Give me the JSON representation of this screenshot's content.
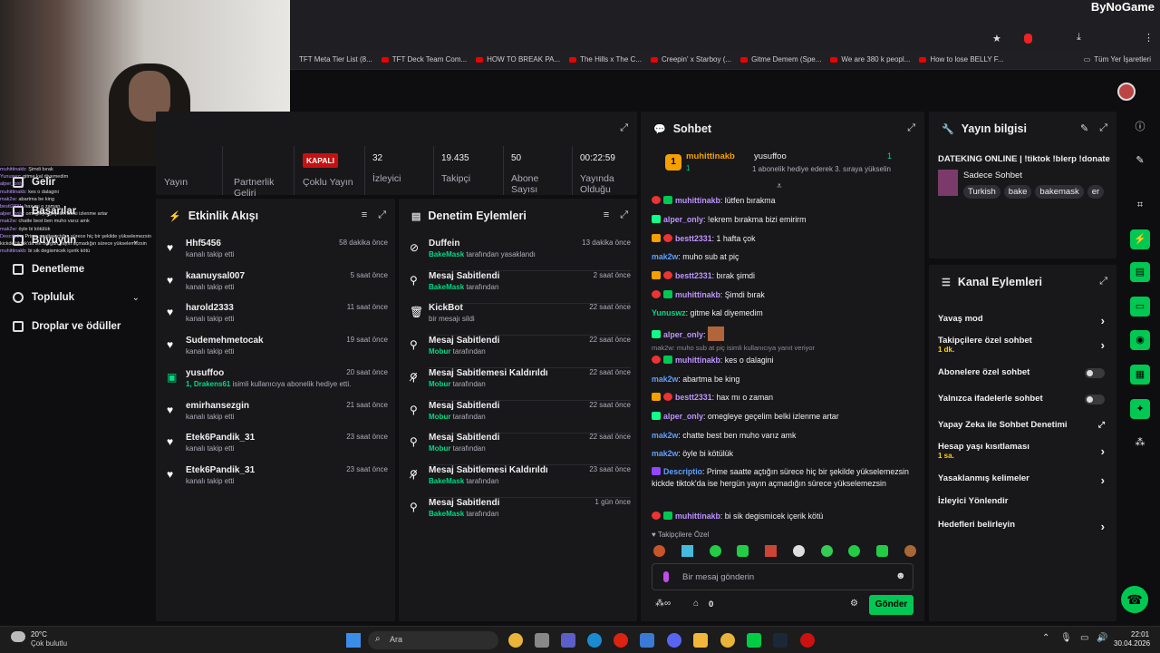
{
  "browser": {
    "brand": "ByNoGame",
    "bookmarks": [
      "TFT Meta Tier List (8...",
      "TFT Deck Team Com...",
      "HOW TO BREAK PA...",
      "The Hills x The C...",
      "Creepin' x Starboy (...",
      "Gitme Demem (Spe...",
      "We are 380 k peopl...",
      "How to lose BELLY F..."
    ],
    "all_bookmarks": "Tüm Yer İşaretleri"
  },
  "nav": {
    "items": [
      {
        "label": "Gelir"
      },
      {
        "label": "Başarılar"
      },
      {
        "label": "Büyüyün"
      },
      {
        "label": "Denetleme"
      },
      {
        "label": "Topluluk"
      },
      {
        "label": "Droplar ve ödüller"
      }
    ]
  },
  "minichat": [
    {
      "u": "muhittinakb",
      "t": "Şimdi bırak"
    },
    {
      "u": "Yunuswz",
      "t": "gitme kal diyemedim"
    },
    {
      "u": "alper_only",
      "t": ""
    },
    {
      "u": "muhittinakb",
      "t": "kes o dalagini"
    },
    {
      "u": "mak2w",
      "t": "abartma be king"
    },
    {
      "u": "bestt2331",
      "t": "hax mı o zaman"
    },
    {
      "u": "alper_only",
      "t": "omegleye geçelim belki izlenme artar"
    },
    {
      "u": "mak2w",
      "t": "chatte best ben muho varız amk"
    },
    {
      "u": "mak2w",
      "t": "öyle bi kötülük"
    },
    {
      "u": "Descriptio",
      "t": "Prime saatte açtığın sürece hiç bir şekilde yükselemezsin kickde tiktok'da ise hergün yayın açmadığın sürece yükselemezsin"
    },
    {
      "u": "muhittinakb",
      "t": "bi sik degismicek içerik kötü"
    }
  ],
  "stats": {
    "labels": [
      "Yayın",
      "Partnerlik Geliri",
      "Çoklu Yayın",
      "İzleyici",
      "Takipçi",
      "Abone Sayısı",
      "Yayında Olduğu"
    ],
    "multistream_status": "KAPALI",
    "viewers": "32",
    "followers": "19.435",
    "subs": "50",
    "uptime": "00:22:59"
  },
  "activity": {
    "title": "Etkinlik Akışı",
    "rows": [
      {
        "name": "Hhf5456",
        "sub": "kanalı takip etti",
        "time": "58 dakika önce",
        "icon": "heart"
      },
      {
        "name": "kaanuysal007",
        "sub": "kanalı takip etti",
        "time": "5 saat önce",
        "icon": "heart"
      },
      {
        "name": "harold2333",
        "sub": "kanalı takip etti",
        "time": "11 saat önce",
        "icon": "heart"
      },
      {
        "name": "Sudemehmetocak",
        "sub": "kanalı takip etti",
        "time": "19 saat önce",
        "icon": "heart"
      },
      {
        "name": "yusuffoo",
        "sub": "isimli kullanıcıya abonelik hediye etti.",
        "hl": "1, Drakens61",
        "time": "20 saat önce",
        "icon": "gift"
      },
      {
        "name": "emirhansezgin",
        "sub": "kanalı takip etti",
        "time": "21 saat önce",
        "icon": "heart"
      },
      {
        "name": "Etek6Pandik_31",
        "sub": "kanalı takip etti",
        "time": "23 saat önce",
        "icon": "heart"
      },
      {
        "name": "Etek6Pandik_31",
        "sub": "kanalı takip etti",
        "time": "23 saat önce",
        "icon": "heart"
      }
    ]
  },
  "moderation": {
    "title": "Denetim Eylemleri",
    "rows": [
      {
        "name": "Duffein",
        "hl": "BakeMask",
        "sub": "tarafından yasaklandı",
        "time": "13 dakika önce",
        "icon": "ban"
      },
      {
        "name": "Mesaj Sabitlendi",
        "hl": "BakeMask",
        "sub": "tarafından",
        "time": "2 saat önce",
        "icon": "pin"
      },
      {
        "name": "KickBot",
        "hl": "",
        "sub": "bir mesajı sildi",
        "time": "22 saat önce",
        "icon": "trash"
      },
      {
        "name": "Mesaj Sabitlendi",
        "hl": "Mobur",
        "sub": "tarafından",
        "time": "22 saat önce",
        "icon": "pin"
      },
      {
        "name": "Mesaj Sabitlemesi Kaldırıldı",
        "hl": "Mobur",
        "sub": "tarafından",
        "time": "22 saat önce",
        "icon": "unpin"
      },
      {
        "name": "Mesaj Sabitlendi",
        "hl": "Mobur",
        "sub": "tarafından",
        "time": "22 saat önce",
        "icon": "pin"
      },
      {
        "name": "Mesaj Sabitlendi",
        "hl": "Mobur",
        "sub": "tarafından",
        "time": "22 saat önce",
        "icon": "pin"
      },
      {
        "name": "Mesaj Sabitlemesi Kaldırıldı",
        "hl": "BakeMask",
        "sub": "tarafından",
        "time": "23 saat önce",
        "icon": "unpin"
      },
      {
        "name": "Mesaj Sabitlendi",
        "hl": "BakeMask",
        "sub": "tarafından",
        "time": "1 gün önce",
        "icon": "pin"
      }
    ]
  },
  "chat": {
    "title": "Sohbet",
    "pinned_user": "muhittinakb",
    "pinned_level": "1",
    "gift_user": "yusuffoo",
    "gift_count": "1",
    "gift_text": "1 abonelik hediye ederek 3. sıraya yükselin",
    "messages": [
      {
        "u": "muhittinakb",
        "c": "#bf94ff",
        "t": "lütfen bırakma",
        "b": [
          "b-red",
          "b-green"
        ]
      },
      {
        "u": "alper_only",
        "c": "#bf94ff",
        "t": "!ekrem bırakma bizi emirirm",
        "b": [
          "b-teal"
        ]
      },
      {
        "u": "bestt2331",
        "c": "#bf94ff",
        "t": "1 hafta çok",
        "b": [
          "b-gold",
          "b-red"
        ]
      },
      {
        "u": "mak2w",
        "c": "#5ea0ff",
        "t": "muho sub at piç",
        "b": []
      },
      {
        "u": "bestt2331",
        "c": "#bf94ff",
        "t": "bırak şimdi",
        "b": [
          "b-gold",
          "b-red"
        ]
      },
      {
        "u": "muhittinakb",
        "c": "#bf94ff",
        "t": "Şimdi bırak",
        "b": [
          "b-red",
          "b-green"
        ]
      },
      {
        "u": "Yunuswz",
        "c": "#00db84",
        "t": "gitme kal diyemedim",
        "b": []
      },
      {
        "u": "alper_only",
        "c": "#bf94ff",
        "t": "",
        "b": [
          "b-teal"
        ]
      },
      {
        "u": "muhittinakb",
        "c": "#bf94ff",
        "t": "kes o dalagini",
        "b": [
          "b-red",
          "b-green"
        ]
      },
      {
        "u": "mak2w",
        "c": "#5ea0ff",
        "t": "abartma be king",
        "b": []
      },
      {
        "u": "bestt2331",
        "c": "#bf94ff",
        "t": "hax mı o zaman",
        "b": [
          "b-gold",
          "b-red"
        ]
      },
      {
        "u": "alper_only",
        "c": "#bf94ff",
        "t": "omegleye geçelim belki izlenme artar",
        "b": [
          "b-teal"
        ]
      },
      {
        "u": "mak2w",
        "c": "#5ea0ff",
        "t": "chatte best ben muho varız amk",
        "b": []
      },
      {
        "u": "mak2w",
        "c": "#5ea0ff",
        "t": "öyle bi kötülük",
        "b": []
      },
      {
        "u": "Descriptio",
        "c": "#5ea0ff",
        "t": "Prime saatte açtığın sürece hiç bir şekilde yükselemezsin kickde tiktok'da ise hergün yayın açmadığın sürece yükselemezsin",
        "b": [
          "b-purple"
        ]
      },
      {
        "u": "muhittinakb",
        "c": "#bf94ff",
        "t": "bi sik degismicek içerik kötü",
        "b": [
          "b-red",
          "b-green"
        ]
      }
    ],
    "reply_note": "mak2w: muho sub at piç isimli kullanıcıya yanıt veriyor",
    "followers_only": "Takipçilere Özel",
    "input_placeholder": "Bir mesaj gönderin",
    "points": "0",
    "send": "Gönder"
  },
  "streaminfo": {
    "title": "Yayın bilgisi",
    "stream_title": "DATEKING ONLINE | !tiktok !blerp !donate",
    "category": "Sadece Sohbet",
    "tags": [
      "Turkish",
      "bake",
      "bakemask",
      "er"
    ]
  },
  "channelactions": {
    "title": "Kanal Eylemleri",
    "items": [
      {
        "label": "Yavaş mod",
        "sub": "",
        "kind": "arrow"
      },
      {
        "label": "Takipçilere özel sohbet",
        "sub": "1 dk.",
        "kind": "arrow"
      },
      {
        "label": "Abonelere özel sohbet",
        "sub": "",
        "kind": "toggle"
      },
      {
        "label": "Yalnızca ifadelerle sohbet",
        "sub": "",
        "kind": "toggle"
      },
      {
        "label": "Yapay Zeka ile Sohbet Denetimi",
        "sub": "",
        "kind": "ext"
      },
      {
        "label": "Hesap yaşı kısıtlaması",
        "sub": "1 sa.",
        "kind": "arrow"
      },
      {
        "label": "Yasaklanmış kelimeler",
        "sub": "",
        "kind": "arrow"
      },
      {
        "label": "İzleyici Yönlendir",
        "sub": "",
        "kind": "none"
      },
      {
        "label": "Hedefleri belirleyin",
        "sub": "",
        "kind": "arrow"
      }
    ]
  },
  "taskbar": {
    "temp": "20°C",
    "weather": "Çok bulutlu",
    "search": "Ara",
    "time": "22:01",
    "date": "30.04.2026"
  },
  "colors": {
    "accent": "#00c853",
    "bg": "#0e0e10",
    "panel": "#18181b",
    "red": "#c81010"
  }
}
